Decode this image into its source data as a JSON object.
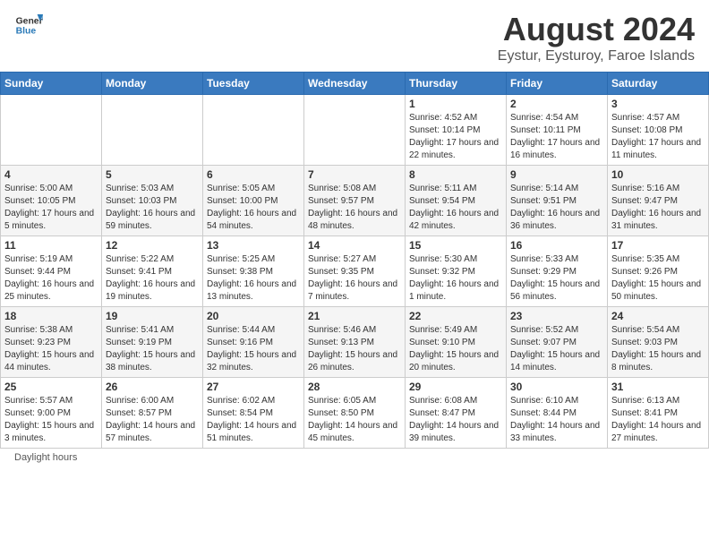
{
  "header": {
    "logo_general": "General",
    "logo_blue": "Blue",
    "main_title": "August 2024",
    "sub_title": "Eystur, Eysturoy, Faroe Islands"
  },
  "days_of_week": [
    "Sunday",
    "Monday",
    "Tuesday",
    "Wednesday",
    "Thursday",
    "Friday",
    "Saturday"
  ],
  "weeks": [
    [
      {
        "day": "",
        "info": ""
      },
      {
        "day": "",
        "info": ""
      },
      {
        "day": "",
        "info": ""
      },
      {
        "day": "",
        "info": ""
      },
      {
        "day": "1",
        "info": "Sunrise: 4:52 AM\nSunset: 10:14 PM\nDaylight: 17 hours and 22 minutes."
      },
      {
        "day": "2",
        "info": "Sunrise: 4:54 AM\nSunset: 10:11 PM\nDaylight: 17 hours and 16 minutes."
      },
      {
        "day": "3",
        "info": "Sunrise: 4:57 AM\nSunset: 10:08 PM\nDaylight: 17 hours and 11 minutes."
      }
    ],
    [
      {
        "day": "4",
        "info": "Sunrise: 5:00 AM\nSunset: 10:05 PM\nDaylight: 17 hours and 5 minutes."
      },
      {
        "day": "5",
        "info": "Sunrise: 5:03 AM\nSunset: 10:03 PM\nDaylight: 16 hours and 59 minutes."
      },
      {
        "day": "6",
        "info": "Sunrise: 5:05 AM\nSunset: 10:00 PM\nDaylight: 16 hours and 54 minutes."
      },
      {
        "day": "7",
        "info": "Sunrise: 5:08 AM\nSunset: 9:57 PM\nDaylight: 16 hours and 48 minutes."
      },
      {
        "day": "8",
        "info": "Sunrise: 5:11 AM\nSunset: 9:54 PM\nDaylight: 16 hours and 42 minutes."
      },
      {
        "day": "9",
        "info": "Sunrise: 5:14 AM\nSunset: 9:51 PM\nDaylight: 16 hours and 36 minutes."
      },
      {
        "day": "10",
        "info": "Sunrise: 5:16 AM\nSunset: 9:47 PM\nDaylight: 16 hours and 31 minutes."
      }
    ],
    [
      {
        "day": "11",
        "info": "Sunrise: 5:19 AM\nSunset: 9:44 PM\nDaylight: 16 hours and 25 minutes."
      },
      {
        "day": "12",
        "info": "Sunrise: 5:22 AM\nSunset: 9:41 PM\nDaylight: 16 hours and 19 minutes."
      },
      {
        "day": "13",
        "info": "Sunrise: 5:25 AM\nSunset: 9:38 PM\nDaylight: 16 hours and 13 minutes."
      },
      {
        "day": "14",
        "info": "Sunrise: 5:27 AM\nSunset: 9:35 PM\nDaylight: 16 hours and 7 minutes."
      },
      {
        "day": "15",
        "info": "Sunrise: 5:30 AM\nSunset: 9:32 PM\nDaylight: 16 hours and 1 minute."
      },
      {
        "day": "16",
        "info": "Sunrise: 5:33 AM\nSunset: 9:29 PM\nDaylight: 15 hours and 56 minutes."
      },
      {
        "day": "17",
        "info": "Sunrise: 5:35 AM\nSunset: 9:26 PM\nDaylight: 15 hours and 50 minutes."
      }
    ],
    [
      {
        "day": "18",
        "info": "Sunrise: 5:38 AM\nSunset: 9:23 PM\nDaylight: 15 hours and 44 minutes."
      },
      {
        "day": "19",
        "info": "Sunrise: 5:41 AM\nSunset: 9:19 PM\nDaylight: 15 hours and 38 minutes."
      },
      {
        "day": "20",
        "info": "Sunrise: 5:44 AM\nSunset: 9:16 PM\nDaylight: 15 hours and 32 minutes."
      },
      {
        "day": "21",
        "info": "Sunrise: 5:46 AM\nSunset: 9:13 PM\nDaylight: 15 hours and 26 minutes."
      },
      {
        "day": "22",
        "info": "Sunrise: 5:49 AM\nSunset: 9:10 PM\nDaylight: 15 hours and 20 minutes."
      },
      {
        "day": "23",
        "info": "Sunrise: 5:52 AM\nSunset: 9:07 PM\nDaylight: 15 hours and 14 minutes."
      },
      {
        "day": "24",
        "info": "Sunrise: 5:54 AM\nSunset: 9:03 PM\nDaylight: 15 hours and 8 minutes."
      }
    ],
    [
      {
        "day": "25",
        "info": "Sunrise: 5:57 AM\nSunset: 9:00 PM\nDaylight: 15 hours and 3 minutes."
      },
      {
        "day": "26",
        "info": "Sunrise: 6:00 AM\nSunset: 8:57 PM\nDaylight: 14 hours and 57 minutes."
      },
      {
        "day": "27",
        "info": "Sunrise: 6:02 AM\nSunset: 8:54 PM\nDaylight: 14 hours and 51 minutes."
      },
      {
        "day": "28",
        "info": "Sunrise: 6:05 AM\nSunset: 8:50 PM\nDaylight: 14 hours and 45 minutes."
      },
      {
        "day": "29",
        "info": "Sunrise: 6:08 AM\nSunset: 8:47 PM\nDaylight: 14 hours and 39 minutes."
      },
      {
        "day": "30",
        "info": "Sunrise: 6:10 AM\nSunset: 8:44 PM\nDaylight: 14 hours and 33 minutes."
      },
      {
        "day": "31",
        "info": "Sunrise: 6:13 AM\nSunset: 8:41 PM\nDaylight: 14 hours and 27 minutes."
      }
    ]
  ],
  "footer": {
    "note": "Daylight hours"
  }
}
